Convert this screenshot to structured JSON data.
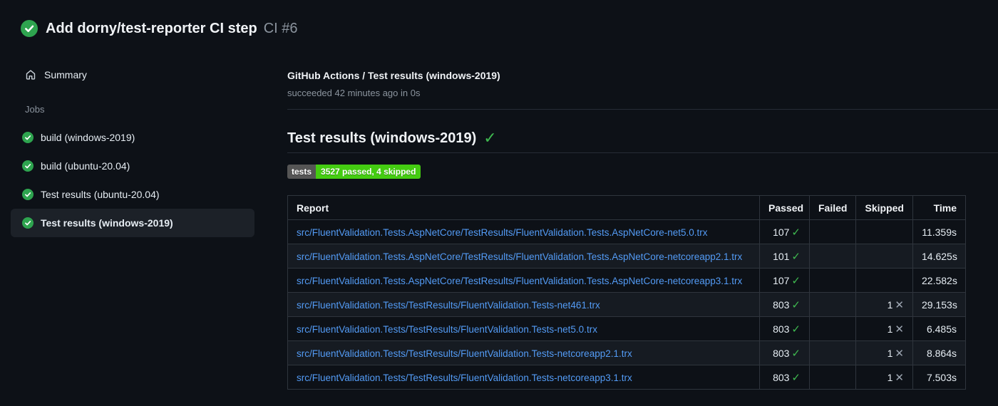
{
  "colors": {
    "bg": "#0d1117",
    "text": "#e6edf3",
    "muted": "#8b949e",
    "link": "#539bf5",
    "success": "#2ea44f",
    "check": "#3fb950",
    "cross": "#9ea7b3",
    "selected_bg": "#1c2128",
    "border": "#2f353d",
    "divider": "#262c36",
    "row_alt": "#161b22",
    "badge_label_bg": "#555555",
    "badge_value_bg": "#44cc11"
  },
  "icons": {
    "check": "✓",
    "cross": "✕"
  },
  "header": {
    "run_title": "Add dorny/test-reporter CI step",
    "run_number": "CI #6"
  },
  "sidebar": {
    "summary_label": "Summary",
    "jobs_label": "Jobs",
    "jobs": [
      {
        "label": "build (windows-2019)",
        "selected": false
      },
      {
        "label": "build (ubuntu-20.04)",
        "selected": false
      },
      {
        "label": "Test results (ubuntu-20.04)",
        "selected": false
      },
      {
        "label": "Test results (windows-2019)",
        "selected": true
      }
    ]
  },
  "main": {
    "check_title": "GitHub Actions / Test results (windows-2019)",
    "check_status": "succeeded 42 minutes ago in 0s",
    "section_title": "Test results (windows-2019)",
    "badge": {
      "label": "tests",
      "value": "3527 passed, 4 skipped"
    },
    "table": {
      "columns": [
        "Report",
        "Passed",
        "Failed",
        "Skipped",
        "Time"
      ],
      "rows": [
        {
          "report": "src/FluentValidation.Tests.AspNetCore/TestResults/FluentValidation.Tests.AspNetCore-net5.0.trx",
          "passed": "107",
          "failed": "",
          "skipped": "",
          "time": "11.359s"
        },
        {
          "report": "src/FluentValidation.Tests.AspNetCore/TestResults/FluentValidation.Tests.AspNetCore-netcoreapp2.1.trx",
          "passed": "101",
          "failed": "",
          "skipped": "",
          "time": "14.625s"
        },
        {
          "report": "src/FluentValidation.Tests.AspNetCore/TestResults/FluentValidation.Tests.AspNetCore-netcoreapp3.1.trx",
          "passed": "107",
          "failed": "",
          "skipped": "",
          "time": "22.582s"
        },
        {
          "report": "src/FluentValidation.Tests/TestResults/FluentValidation.Tests-net461.trx",
          "passed": "803",
          "failed": "",
          "skipped": "1",
          "time": "29.153s"
        },
        {
          "report": "src/FluentValidation.Tests/TestResults/FluentValidation.Tests-net5.0.trx",
          "passed": "803",
          "failed": "",
          "skipped": "1",
          "time": "6.485s"
        },
        {
          "report": "src/FluentValidation.Tests/TestResults/FluentValidation.Tests-netcoreapp2.1.trx",
          "passed": "803",
          "failed": "",
          "skipped": "1",
          "time": "8.864s"
        },
        {
          "report": "src/FluentValidation.Tests/TestResults/FluentValidation.Tests-netcoreapp3.1.trx",
          "passed": "803",
          "failed": "",
          "skipped": "1",
          "time": "7.503s"
        }
      ]
    }
  }
}
